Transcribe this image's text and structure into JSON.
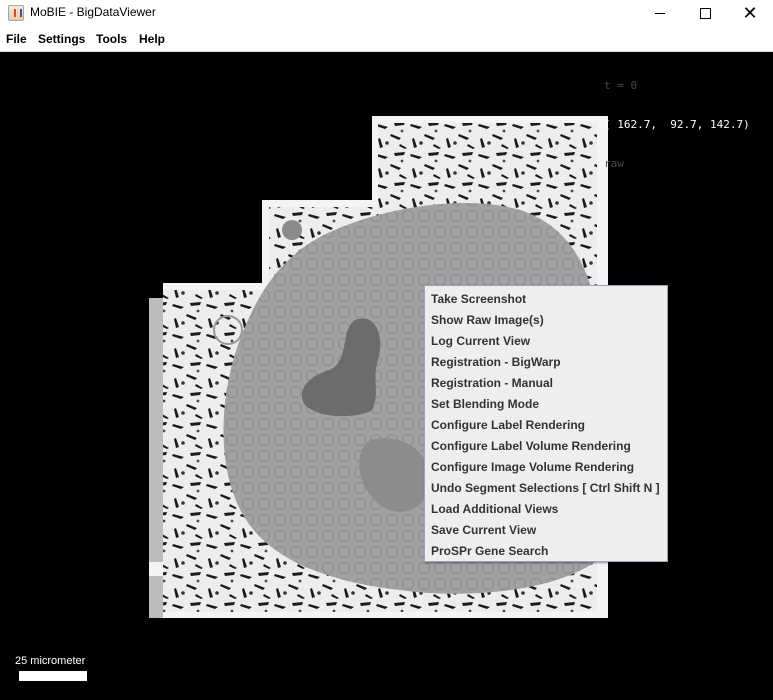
{
  "window": {
    "title": "MoBIE - BigDataViewer",
    "icon": "java-app-icon",
    "close_glyph": "✕"
  },
  "menubar": {
    "items": [
      "File",
      "Settings",
      "Tools",
      "Help"
    ]
  },
  "overlay": {
    "time": "t = 0",
    "coords": "( 162.7,  92.7, 142.7)",
    "source": "raw"
  },
  "scalebar": {
    "label": "25 micrometer"
  },
  "context_menu": {
    "items": [
      "Take Screenshot",
      "Show Raw Image(s)",
      "Log Current View",
      "Registration - BigWarp",
      "Registration - Manual",
      "Set Blending Mode",
      "Configure Label Rendering",
      "Configure Label Volume Rendering",
      "Configure Image Volume Rendering",
      "Undo Segment Selections [ Ctrl Shift N ]",
      "Load Additional Views",
      "Save Current View",
      "ProSPr Gene Search"
    ]
  }
}
